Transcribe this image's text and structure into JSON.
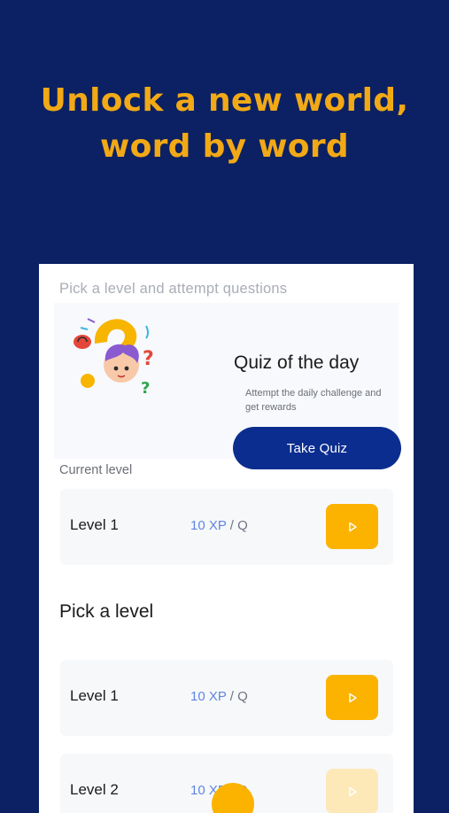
{
  "headline": {
    "line1": "Unlock a new world,",
    "line2": "word by word"
  },
  "card": {
    "subtitle": "Pick a level and attempt questions",
    "quiz": {
      "title": "Quiz of the day",
      "description": "Attempt the daily challenge and get rewards",
      "button_label": "Take Quiz",
      "illustration": "question-mark-character-illustration"
    },
    "current_level": {
      "label": "Current level",
      "name": "Level 1",
      "xp": "10 XP",
      "per": " / Q",
      "action_icon": "play-icon"
    },
    "pick_level": {
      "heading": "Pick a level",
      "levels": [
        {
          "name": "Level 1",
          "xp": "10 XP",
          "per": " / Q",
          "action_icon": "play-icon",
          "locked": false
        },
        {
          "name": "Level 2",
          "xp": "10 XP",
          "per": " / Q",
          "action_icon": "play-icon",
          "locked": true
        }
      ]
    }
  },
  "colors": {
    "background": "#0b2163",
    "headline": "#f2a916",
    "primary_button": "#0b2d8f",
    "accent": "#fbb300",
    "xp": "#5f86e0"
  }
}
